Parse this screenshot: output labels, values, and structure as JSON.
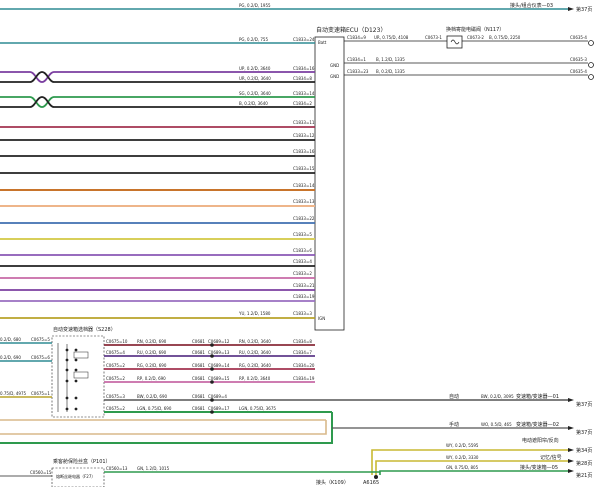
{
  "top_wire": {
    "label": "PG, 0.2/D, 1955",
    "dest": "接头/组合仪表—03",
    "page": "第37页"
  },
  "ecu": {
    "title": "自动变速箱ECU（D123）",
    "pins": {
      "batt": "Batt",
      "gnd1": "GND",
      "gnd2": "GND",
      "ign": "IGN"
    }
  },
  "solenoid": {
    "title": "换档寄能电磁阀（N117）",
    "conn_left": "C0673-1",
    "conn_right": "C0673-2",
    "wire_in": "UR, 0.75/D, 4108",
    "wire_out": "B, 0.75/D, 2250"
  },
  "gnd_refs": {
    "g1": "C0635-4",
    "g2": "C0635-3",
    "g3": "C0635-4"
  },
  "batt_wire": {
    "label": "PG, 0.2/D, 755",
    "pin": "C1833=24"
  },
  "left_wires": [
    {
      "id": "w1",
      "label": "UP, 0.2/D, 3640",
      "pin": "C1834=16"
    },
    {
      "id": "w2",
      "label": "UR, 0.2/D, 3640",
      "pin": "C1834=8"
    },
    {
      "id": "w3",
      "label": "SG, 0.2/D, 3640",
      "pin": "C1833=14"
    },
    {
      "id": "w4",
      "label": "B, 0.2/D, 3640",
      "pin": "C1834=2"
    },
    {
      "id": "w5",
      "label": "",
      "pin": "C1833=11"
    },
    {
      "id": "w6",
      "label": "",
      "pin": "C1833=12"
    },
    {
      "id": "w7",
      "label": "",
      "pin": "C1833=16"
    },
    {
      "id": "w8",
      "label": "",
      "pin": "C1833=15"
    },
    {
      "id": "w9",
      "label": "",
      "pin": "C1833=14"
    },
    {
      "id": "w10",
      "label": "",
      "pin": "C1833=13"
    },
    {
      "id": "w11",
      "label": "",
      "pin": "C1833=22"
    },
    {
      "id": "w12",
      "label": "",
      "pin": "C1833=5"
    },
    {
      "id": "w13",
      "label": "",
      "pin": "C1833=6"
    },
    {
      "id": "w14",
      "label": "",
      "pin": "C1833=4"
    },
    {
      "id": "w15",
      "label": "",
      "pin": "C1833=2"
    },
    {
      "id": "w16",
      "label": "",
      "pin": "C1833=21"
    },
    {
      "id": "w17",
      "label": "",
      "pin": "C1833=19"
    },
    {
      "id": "w18",
      "label": "YU, 1.2/D, 1580",
      "pin": "C1833=3"
    }
  ],
  "gnd_wires": [
    {
      "id": "g1",
      "pin": "C1834=1",
      "label": "B, 1.2/D, 1335"
    },
    {
      "id": "g2",
      "pin": "C1833=23",
      "label": "B, 0.2/D, 1335"
    }
  ],
  "selector": {
    "title": "自动变速箱选档器（S228）",
    "left_wires": [
      {
        "label": "0.2/D, 680",
        "pin": "C0675=5"
      },
      {
        "label": "0.2/D, 690",
        "pin": "C0675=6"
      },
      {
        "label": "0.75/D, 4975",
        "pin": "C0675=1"
      }
    ],
    "rows": [
      {
        "pin": "C0675=10",
        "w1": "RN, 0.2/D, 690",
        "j1": "C0681",
        "j2": "C0689=12",
        "w2": "RN, 0.2/D, 3640",
        "ecu": "C1834=8"
      },
      {
        "pin": "C0675=4",
        "w1": "RU, 0.2/D, 690",
        "j1": "C0681",
        "j2": "C0689=13",
        "w2": "RU, 0.2/D, 3640",
        "ecu": "C1834=7"
      },
      {
        "pin": "C0675=2",
        "w1": "RG, 0.2/D, 690",
        "j1": "C0681",
        "j2": "C0689=14",
        "w2": "RG, 0.2/D, 3640",
        "ecu": "C1834=20"
      },
      {
        "pin": "C0675=2",
        "w1": "RP, 0.2/D, 690",
        "j1": "C0681",
        "j2": "C0689=15",
        "w2": "RP, 0.2/D, 3640",
        "ecu": "C1834=19"
      },
      {
        "pin": "C0675=3",
        "w1": "BW, 0.2/D, 690",
        "j1": "C0681",
        "j2": "C0689=4",
        "w2": "",
        "ecu": ""
      },
      {
        "pin": "C0675=2",
        "w1": "LGN, 0.75/D, 690",
        "j1": "C0681",
        "j2": "C0689=17",
        "w2": "LGN, 0.75/D, 3675",
        "ecu": ""
      }
    ]
  },
  "right_refs": [
    {
      "mode": "自动",
      "label": "BW, 0.2/D, 3095",
      "dest": "变速箱/变速器—01",
      "page": "第37页"
    },
    {
      "mode": "手动",
      "label": "WO, 0.5/D, 465",
      "dest": "变速箱/变速器—02",
      "page": "第37页"
    },
    {
      "mode": "",
      "label": "WY, 0.2/D, 5595",
      "dest": "电动遮阳帘/反向",
      "page": "第34页"
    },
    {
      "mode": "",
      "label": "WY, 0.2/D, 3330",
      "dest": "记忆/信号",
      "page": "第28页"
    },
    {
      "mode": "",
      "label": "GN, 0.75/D, 805",
      "dest": "接头/变速箱—05",
      "page": "第21页"
    }
  ],
  "passenger": {
    "title": "乘客舱保险丝盒（P101）",
    "conn": "C0560=13",
    "wire": "GN, 1.2/D, 1015",
    "left_pin": "C0560=15",
    "fuse": "熔断丝继电器（F27）"
  },
  "bottom": {
    "joint": "接头（K109）",
    "code": "A6165"
  }
}
